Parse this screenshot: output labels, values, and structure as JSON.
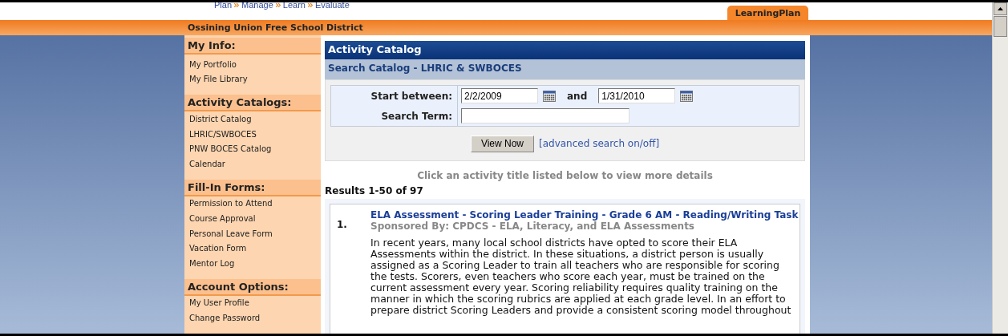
{
  "top_nav": [
    "Plan",
    "Manage",
    "Learn",
    "Evaluate"
  ],
  "app_tab": {
    "label": "LearningPlan",
    "selected": true
  },
  "district": "Ossining Union Free School District",
  "sidebar": [
    {
      "heading": "My Info:",
      "items": [
        "My Portfolio",
        "My File Library"
      ]
    },
    {
      "heading": "Activity Catalogs:",
      "items": [
        "District Catalog",
        "LHRIC/SWBOCES",
        "PNW BOCES Catalog",
        "Calendar"
      ]
    },
    {
      "heading": "Fill-In Forms:",
      "items": [
        "Permission to Attend",
        "Course Approval",
        "Personal Leave Form",
        "Vacation Form",
        "Mentor Log"
      ]
    },
    {
      "heading": "Account Options:",
      "items": [
        "My User Profile",
        "Change Password"
      ]
    }
  ],
  "panel_title": "Activity Catalog",
  "panel_subtitle": "Search Catalog - LHRIC & SWBOCES",
  "form": {
    "start_label": "Start between:",
    "start_value": "2/2/2009",
    "and_label": "and",
    "end_value": "1/31/2010",
    "term_label": "Search Term:"
  },
  "view_button": "View Now",
  "advanced_link": "[advanced search on/off]",
  "hint": "Click an activity title listed below to view more details",
  "results_count": "Results 1-50 of 97",
  "results": [
    {
      "number": "1.",
      "title": "ELA Assessment - Scoring Leader Training - Grade 6 AM - Reading/Writing Task",
      "sponsor": "Sponsored By: CPDCS - ELA, Literacy, and ELA Assessments",
      "description_lines": [
        "In recent years, many local school districts have opted to score their ELA",
        "Assessments within the district. In these situations, a district person is usually",
        "assigned as a Scoring Leader to train all teachers who are responsible for scoring",
        "the tests. Scorers, even teachers who score each year, must be trained on the",
        "current assessment every year. Scoring reliability requires quality training on the",
        "manner in which the scoring rubrics are applied at each grade level. In an effort to",
        "prepare district Scoring Leaders and provide a consistent scoring model throughout"
      ]
    }
  ]
}
